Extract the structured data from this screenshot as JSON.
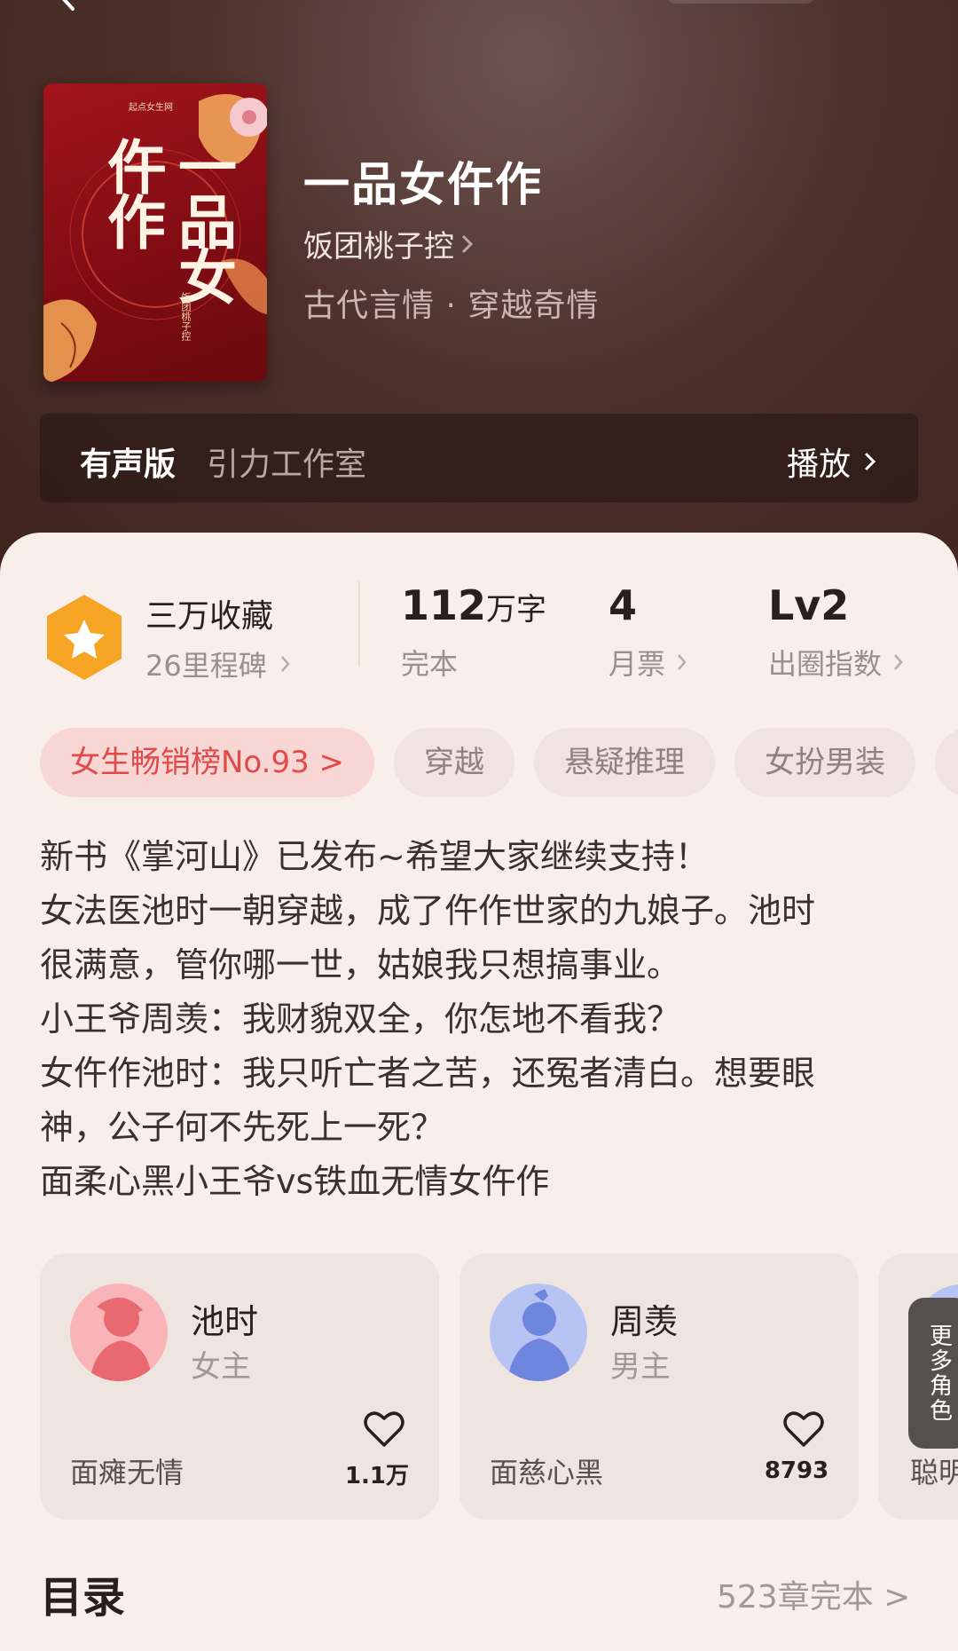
{
  "book": {
    "title": "一品女仵作",
    "author": "饭团桃子控",
    "genre": "古代言情 · 穿越奇情",
    "cover": {
      "publisher": "起点女生网",
      "title_text": "一品女仵作",
      "author_text": "饭团桃子控"
    }
  },
  "audio": {
    "label": "有声版",
    "studio": "引力工作室",
    "play_label": "播放"
  },
  "stats": {
    "favorites_title": "三万收藏",
    "favorites_sub": "26里程碑",
    "words_value": "112",
    "words_unit": "万字",
    "words_status": "完本",
    "monthly_votes_value": "4",
    "monthly_votes_label": "月票",
    "level_value": "Lv2",
    "level_label": "出圈指数"
  },
  "tags": [
    {
      "label": "女生畅销榜No.93 >"
    },
    {
      "label": "穿越"
    },
    {
      "label": "悬疑推理"
    },
    {
      "label": "女扮男装"
    }
  ],
  "description": [
    "新书《掌河山》已发布~希望大家继续支持！",
    "女法医池时一朝穿越，成了仵作世家的九娘子。池时",
    "很满意，管你哪一世，姑娘我只想搞事业。",
    "小王爷周羡：我财貌双全，你怎地不看我？",
    "女仵作池时：我只听亡者之苦，还冤者清白。想要眼",
    "神，公子何不先死上一死？",
    "面柔心黑小王爷vs铁血无情女仵作"
  ],
  "characters": [
    {
      "name": "池时",
      "role": "女主",
      "trait": "面瘫无情",
      "likes": "1.1万",
      "avatar_color": "#f08a8e"
    },
    {
      "name": "周羡",
      "role": "男主",
      "trait": "面慈心黑",
      "likes": "8793",
      "avatar_color": "#8ea2e6"
    }
  ],
  "more_characters": {
    "label": "更多角色",
    "partial_trait": "聪明"
  },
  "toc": {
    "title": "目录",
    "count": "523章完本 >"
  },
  "colors": {
    "accent_red": "#e14a4a",
    "star_orange": "#f6a423",
    "hero_bg": "#4d302a"
  }
}
